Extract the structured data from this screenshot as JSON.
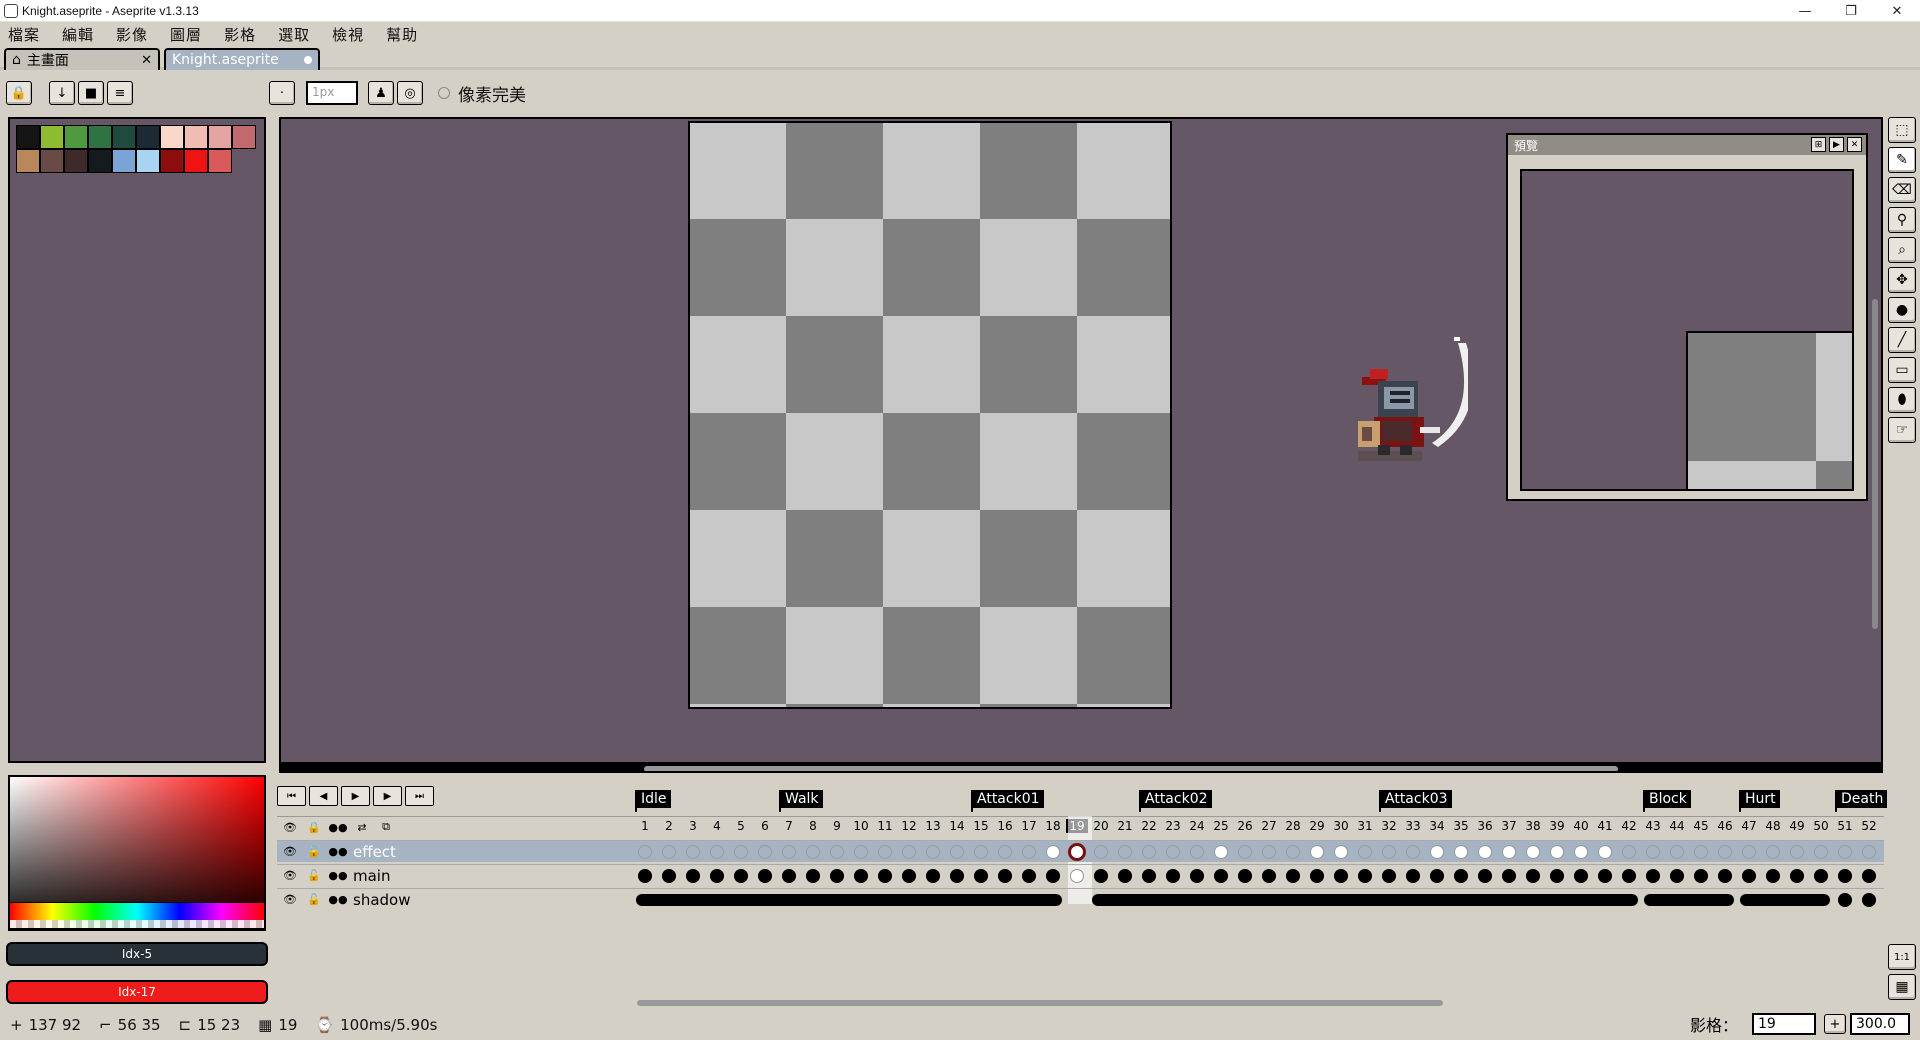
{
  "window": {
    "title": "Knight.aseprite - Aseprite v1.3.13",
    "minimize": "—",
    "restore": "❐",
    "close": "✕"
  },
  "menu": [
    "檔案",
    "編輯",
    "影像",
    "圖層",
    "影格",
    "選取",
    "檢視",
    "幫助"
  ],
  "tabs": {
    "home_label": "主畫面",
    "home_close": "✕",
    "active_label": "Knight.aseprite"
  },
  "toolbar": {
    "lock_icon": "lock-icon",
    "brush_size_placeholder": "1px",
    "pixel_perfect_label": "像素完美"
  },
  "palette": {
    "row1": [
      "#141414",
      "#8ebb2f",
      "#4f9a40",
      "#2f7342",
      "#214a3e",
      "#1c2b33",
      "#f8d8c8",
      "#f2bcb2",
      "#e4a4a4",
      "#c26a6e"
    ],
    "row2": [
      "#b8885a",
      "#6a4a44",
      "#3e2a2a",
      "#151a1e",
      "#78a4d6",
      "#a8d4f2",
      "#8e0e0e",
      "#ee1414",
      "#d85a5a"
    ]
  },
  "colors": {
    "fg_label": "Idx-5",
    "bg_label": "Idx-17",
    "fg": "#283038",
    "bg": "#ef1c1c",
    "canvas_bg": "#665766"
  },
  "preview": {
    "title": "預覽"
  },
  "timeline": {
    "tags": [
      {
        "label": "Idle",
        "start": 1
      },
      {
        "label": "Walk",
        "start": 7
      },
      {
        "label": "Attack01",
        "start": 15
      },
      {
        "label": "Attack02",
        "start": 22
      },
      {
        "label": "Attack03",
        "start": 32
      },
      {
        "label": "Block",
        "start": 43
      },
      {
        "label": "Hurt",
        "start": 47
      },
      {
        "label": "Death",
        "start": 51
      }
    ],
    "frame_count_visible": 52,
    "current_frame": 19,
    "layers": [
      {
        "name": "effect",
        "selected": true
      },
      {
        "name": "main",
        "selected": false
      },
      {
        "name": "shadow",
        "selected": false
      }
    ],
    "effect_white_frames": [
      18,
      25,
      29,
      30,
      34,
      35,
      36,
      37,
      38,
      39,
      40,
      41
    ]
  },
  "status": {
    "cursor": "137 92",
    "size": "56 35",
    "selection": "15 23",
    "frame": "19",
    "duration": "100ms/5.90s"
  },
  "frame_control": {
    "label": "影格：",
    "value": "19",
    "plus": "+",
    "zoom": "300.0"
  }
}
